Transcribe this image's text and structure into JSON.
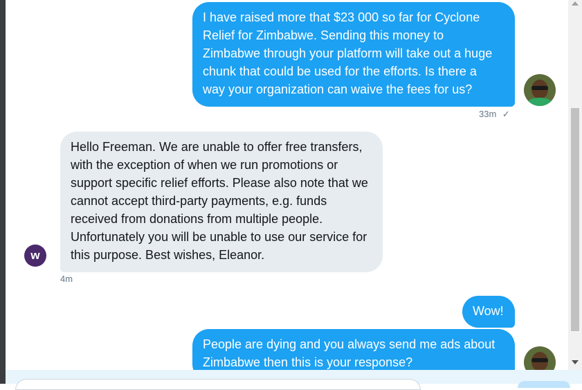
{
  "messages": [
    {
      "direction": "outgoing",
      "lines": [
        "I have raised more that $23 000 so far for Cyclone",
        "Relief for Zimbabwe. Sending this money to",
        "Zimbabwe through your platform will take out a huge",
        "chunk that could be used for the efforts. Is there a",
        "way your organization can waive the fees for us?"
      ],
      "time": "33m",
      "status": "✓"
    },
    {
      "direction": "incoming",
      "lines": [
        "Hello Freeman. We are unable to offer free transfers,",
        "with the exception of when we run promotions or",
        "support specific relief efforts. Please also note that we",
        "cannot accept third-party payments, e.g. funds",
        "received from donations from multiple people.",
        "Unfortunately you will be unable to use our service for",
        "this purpose. Best wishes, Eleanor."
      ],
      "time": "4m",
      "avatar_letter": "w"
    },
    {
      "direction": "outgoing",
      "text": "Wow!"
    },
    {
      "direction": "outgoing",
      "lines": [
        "People are dying and you always send me ads about",
        "Zimbabwe then this is your response?"
      ]
    }
  ],
  "colors": {
    "outgoing_bubble": "#1da1f2",
    "incoming_bubble": "#e6ecf0",
    "brand_avatar": "#4a2a6b"
  }
}
